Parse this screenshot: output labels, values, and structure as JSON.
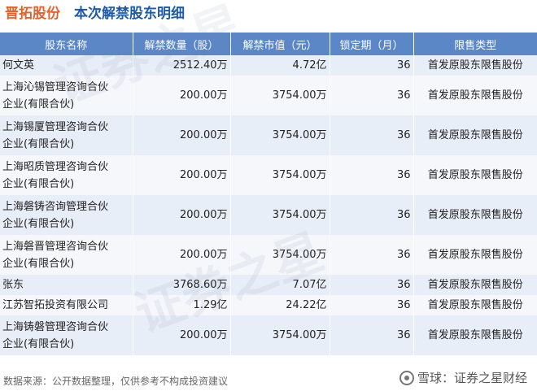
{
  "header": {
    "company": "晋拓股份",
    "title": "本次解禁股东明细"
  },
  "table": {
    "columns": [
      "股东名称",
      "解禁数量（股）",
      "解禁市值（元）",
      "锁定期（月）",
      "限售类型"
    ],
    "rows": [
      {
        "name_line1": "何文英",
        "name_line2": "",
        "quantity": "2512.40万",
        "value": "4.72亿",
        "lock_months": "36",
        "type": "首发原股东限售股份"
      },
      {
        "name_line1": "上海沁锡管理咨询合伙",
        "name_line2": "企业(有限合伙)",
        "quantity": "200.00万",
        "value": "3754.00万",
        "lock_months": "36",
        "type": "首发原股东限售股份"
      },
      {
        "name_line1": "上海锡厦管理咨询合伙",
        "name_line2": "企业(有限合伙)",
        "quantity": "200.00万",
        "value": "3754.00万",
        "lock_months": "36",
        "type": "首发原股东限售股份"
      },
      {
        "name_line1": "上海昭质管理咨询合伙",
        "name_line2": "企业(有限合伙)",
        "quantity": "200.00万",
        "value": "3754.00万",
        "lock_months": "36",
        "type": "首发原股东限售股份"
      },
      {
        "name_line1": "上海磐铸咨询管理合伙",
        "name_line2": "企业(有限合伙)",
        "quantity": "200.00万",
        "value": "3754.00万",
        "lock_months": "36",
        "type": "首发原股东限售股份"
      },
      {
        "name_line1": "上海磐晋管理咨询合伙",
        "name_line2": "企业(有限合伙)",
        "quantity": "200.00万",
        "value": "3754.00万",
        "lock_months": "36",
        "type": "首发原股东限售股份"
      },
      {
        "name_line1": "张东",
        "name_line2": "",
        "quantity": "3768.60万",
        "value": "7.07亿",
        "lock_months": "36",
        "type": "首发原股东限售股份"
      },
      {
        "name_line1": "江苏智拓投资有限公司",
        "name_line2": "",
        "quantity": "1.29亿",
        "value": "24.22亿",
        "lock_months": "36",
        "type": "首发原股东限售股份"
      },
      {
        "name_line1": "上海铸磐管理咨询合伙",
        "name_line2": "企业(有限合伙)",
        "quantity": "200.00万",
        "value": "3754.00万",
        "lock_months": "36",
        "type": "首发原股东限售股份"
      }
    ]
  },
  "footer": {
    "source_note": "数据来源：公开数据整理，仅供参考不构成投资建议",
    "brand": "雪球：证券之星财经"
  },
  "watermark": {
    "text1": "证券之星",
    "text2": "证券之星"
  }
}
